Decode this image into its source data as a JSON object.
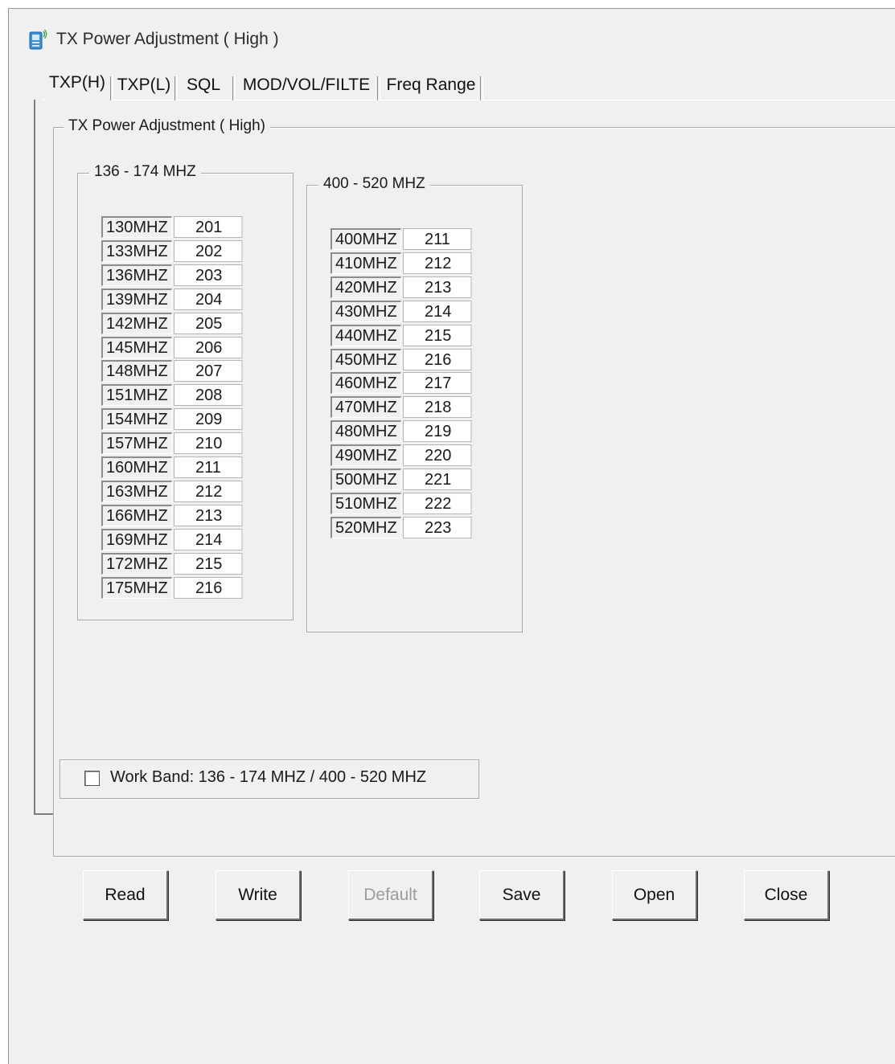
{
  "window": {
    "title": "TX Power Adjustment ( High )",
    "icon": "handheld-radio-icon"
  },
  "tabs": [
    {
      "label": "TXP(H)",
      "active": true
    },
    {
      "label": "TXP(L)",
      "active": false
    },
    {
      "label": "SQL",
      "active": false
    },
    {
      "label": "MOD/VOL/FILTE",
      "active": false
    },
    {
      "label": "Freq Range",
      "active": false
    }
  ],
  "main_group": {
    "title": "TX Power Adjustment ( High)"
  },
  "vhf_group": {
    "title": "136 - 174  MHZ",
    "rows": [
      {
        "freq": "130MHZ",
        "value": "201"
      },
      {
        "freq": "133MHZ",
        "value": "202"
      },
      {
        "freq": "136MHZ",
        "value": "203"
      },
      {
        "freq": "139MHZ",
        "value": "204"
      },
      {
        "freq": "142MHZ",
        "value": "205"
      },
      {
        "freq": "145MHZ",
        "value": "206"
      },
      {
        "freq": "148MHZ",
        "value": "207"
      },
      {
        "freq": "151MHZ",
        "value": "208"
      },
      {
        "freq": "154MHZ",
        "value": "209"
      },
      {
        "freq": "157MHZ",
        "value": "210"
      },
      {
        "freq": "160MHZ",
        "value": "211"
      },
      {
        "freq": "163MHZ",
        "value": "212"
      },
      {
        "freq": "166MHZ",
        "value": "213"
      },
      {
        "freq": "169MHZ",
        "value": "214"
      },
      {
        "freq": "172MHZ",
        "value": "215"
      },
      {
        "freq": "175MHZ",
        "value": "216"
      }
    ]
  },
  "uhf_group": {
    "title": "400 - 520  MHZ",
    "rows": [
      {
        "freq": "400MHZ",
        "value": "211"
      },
      {
        "freq": "410MHZ",
        "value": "212"
      },
      {
        "freq": "420MHZ",
        "value": "213"
      },
      {
        "freq": "430MHZ",
        "value": "214"
      },
      {
        "freq": "440MHZ",
        "value": "215"
      },
      {
        "freq": "450MHZ",
        "value": "216"
      },
      {
        "freq": "460MHZ",
        "value": "217"
      },
      {
        "freq": "470MHZ",
        "value": "218"
      },
      {
        "freq": "480MHZ",
        "value": "219"
      },
      {
        "freq": "490MHZ",
        "value": "220"
      },
      {
        "freq": "500MHZ",
        "value": "221"
      },
      {
        "freq": "510MHZ",
        "value": "222"
      },
      {
        "freq": "520MHZ",
        "value": "223"
      }
    ]
  },
  "work_band": {
    "label": "Work Band: 136 - 174 MHZ / 400 - 520 MHZ",
    "checked": false
  },
  "buttons": {
    "read": "Read",
    "write": "Write",
    "default": "Default",
    "save": "Save",
    "open": "Open",
    "close": "Close"
  }
}
